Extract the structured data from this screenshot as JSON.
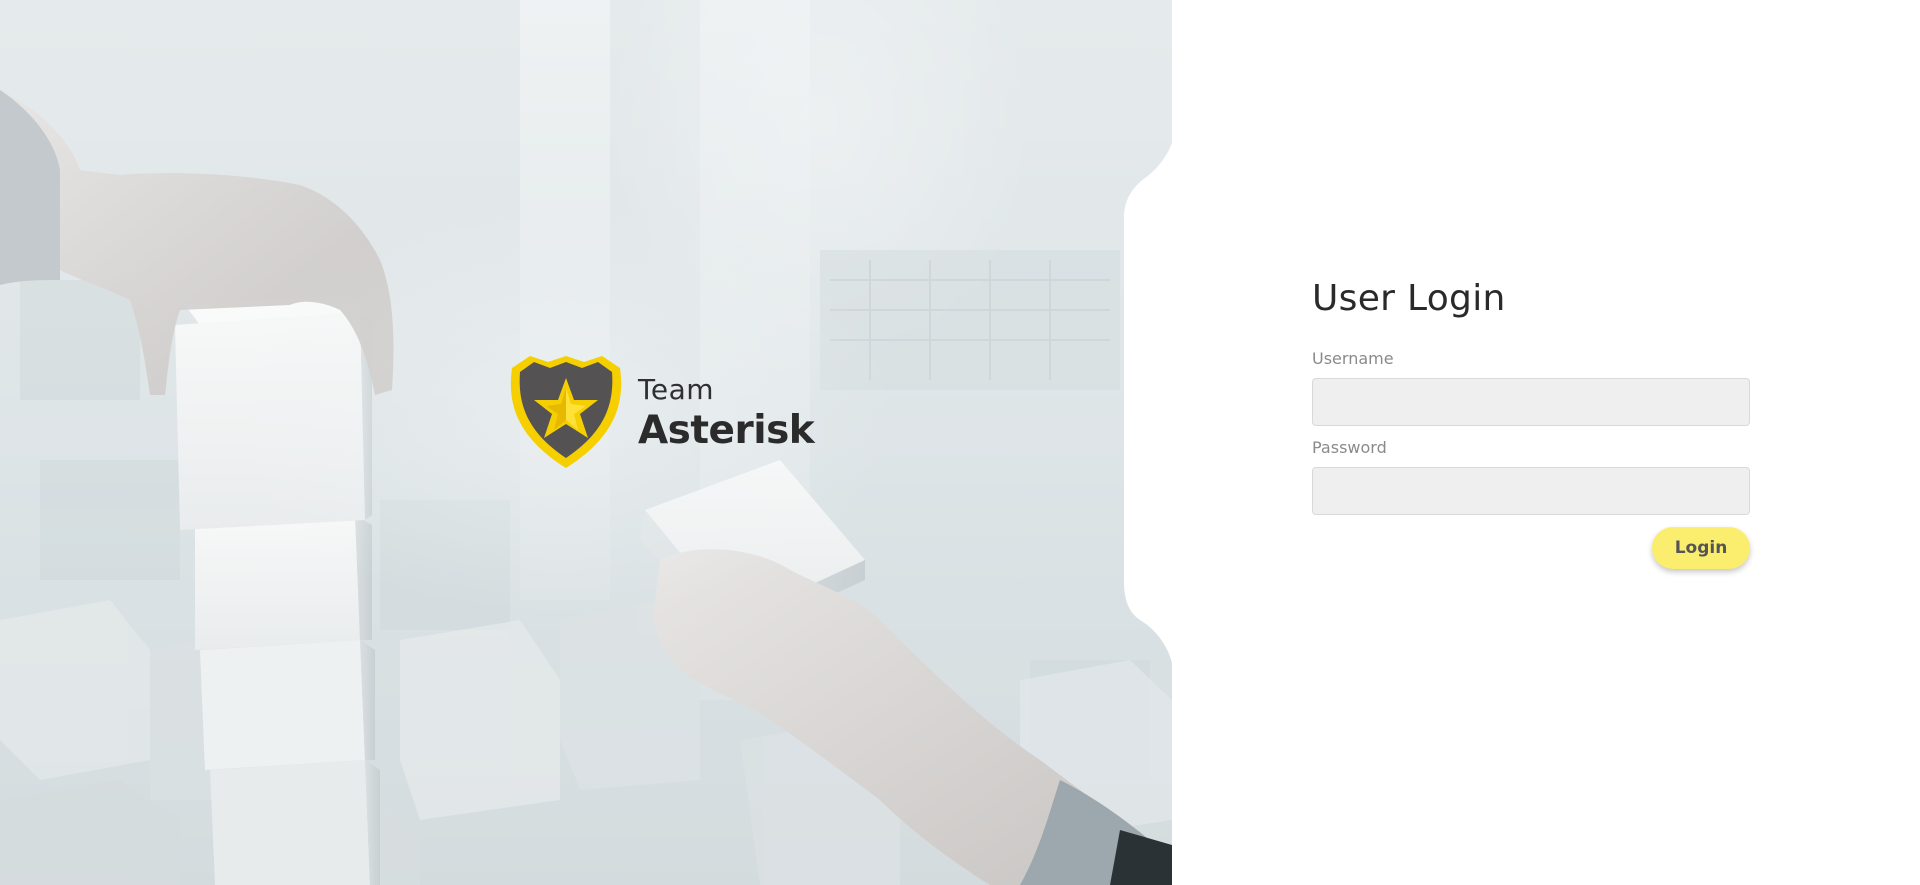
{
  "brand": {
    "line1": "Team",
    "line2": "Asterisk",
    "logo_icon": "shield-star-logo",
    "accent_color": "#f5cf00",
    "shield_color": "#545253"
  },
  "login": {
    "title": "User Login",
    "username_label": "Username",
    "username_value": "",
    "password_label": "Password",
    "password_value": "",
    "submit_label": "Login",
    "button_color": "#fbee6e"
  },
  "hero": {
    "image": "hands-stacking-white-blocks-photo"
  }
}
